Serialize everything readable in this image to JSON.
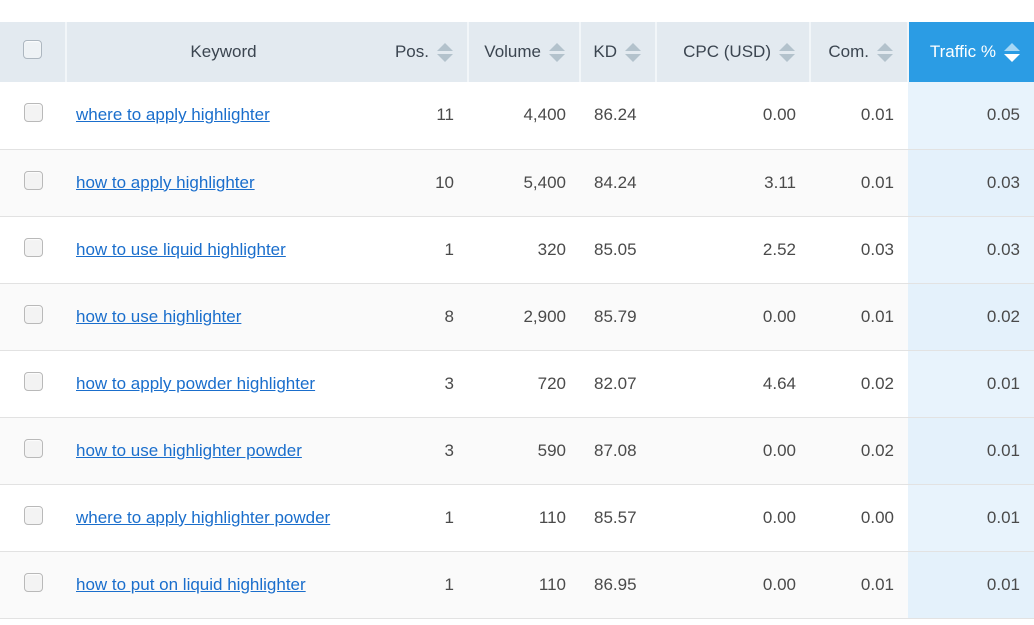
{
  "table": {
    "columns": [
      {
        "key": "checkbox",
        "label": "",
        "icon": "checkbox-icon",
        "sortable": false,
        "align": "center"
      },
      {
        "key": "keyword",
        "label": "Keyword",
        "sortable": false,
        "align": "center"
      },
      {
        "key": "pos",
        "label": "Pos.",
        "sortable": true,
        "align": "right"
      },
      {
        "key": "volume",
        "label": "Volume",
        "sortable": true,
        "align": "right"
      },
      {
        "key": "kd",
        "label": "KD",
        "sortable": true,
        "align": "left"
      },
      {
        "key": "cpc",
        "label": "CPC (USD)",
        "sortable": true,
        "align": "right"
      },
      {
        "key": "com",
        "label": "Com.",
        "sortable": true,
        "align": "right"
      },
      {
        "key": "traffic",
        "label": "Traffic %",
        "sortable": true,
        "align": "right",
        "active_sort": true,
        "sort_direction": "desc"
      }
    ],
    "active_sort_column": "Traffic %",
    "rows": [
      {
        "keyword": "where to apply highlighter",
        "pos": "11",
        "volume": "4,400",
        "kd": "86.24",
        "cpc": "0.00",
        "com": "0.01",
        "traffic": "0.05"
      },
      {
        "keyword": "how to apply highlighter",
        "pos": "10",
        "volume": "5,400",
        "kd": "84.24",
        "cpc": "3.11",
        "com": "0.01",
        "traffic": "0.03"
      },
      {
        "keyword": "how to use liquid highlighter",
        "pos": "1",
        "volume": "320",
        "kd": "85.05",
        "cpc": "2.52",
        "com": "0.03",
        "traffic": "0.03"
      },
      {
        "keyword": "how to use highlighter",
        "pos": "8",
        "volume": "2,900",
        "kd": "85.79",
        "cpc": "0.00",
        "com": "0.01",
        "traffic": "0.02"
      },
      {
        "keyword": "how to apply powder highlighter",
        "pos": "3",
        "volume": "720",
        "kd": "82.07",
        "cpc": "4.64",
        "com": "0.02",
        "traffic": "0.01"
      },
      {
        "keyword": "how to use highlighter powder",
        "pos": "3",
        "volume": "590",
        "kd": "87.08",
        "cpc": "0.00",
        "com": "0.02",
        "traffic": "0.01"
      },
      {
        "keyword": "where to apply highlighter powder",
        "pos": "1",
        "volume": "110",
        "kd": "85.57",
        "cpc": "0.00",
        "com": "0.00",
        "traffic": "0.01"
      },
      {
        "keyword": "how to put on liquid highlighter",
        "pos": "1",
        "volume": "110",
        "kd": "86.95",
        "cpc": "0.00",
        "com": "0.01",
        "traffic": "0.01"
      }
    ]
  },
  "colors": {
    "header_bg": "#e3eaf0",
    "header_text": "#3b4550",
    "active_sort_bg": "#2b9ce4",
    "active_sort_text": "#ffffff",
    "link": "#1a6ecc",
    "traffic_cell_bg": "#e8f3fc",
    "row_alt_bg": "#fafafa",
    "sorter_inactive": "#b3c2cc"
  }
}
